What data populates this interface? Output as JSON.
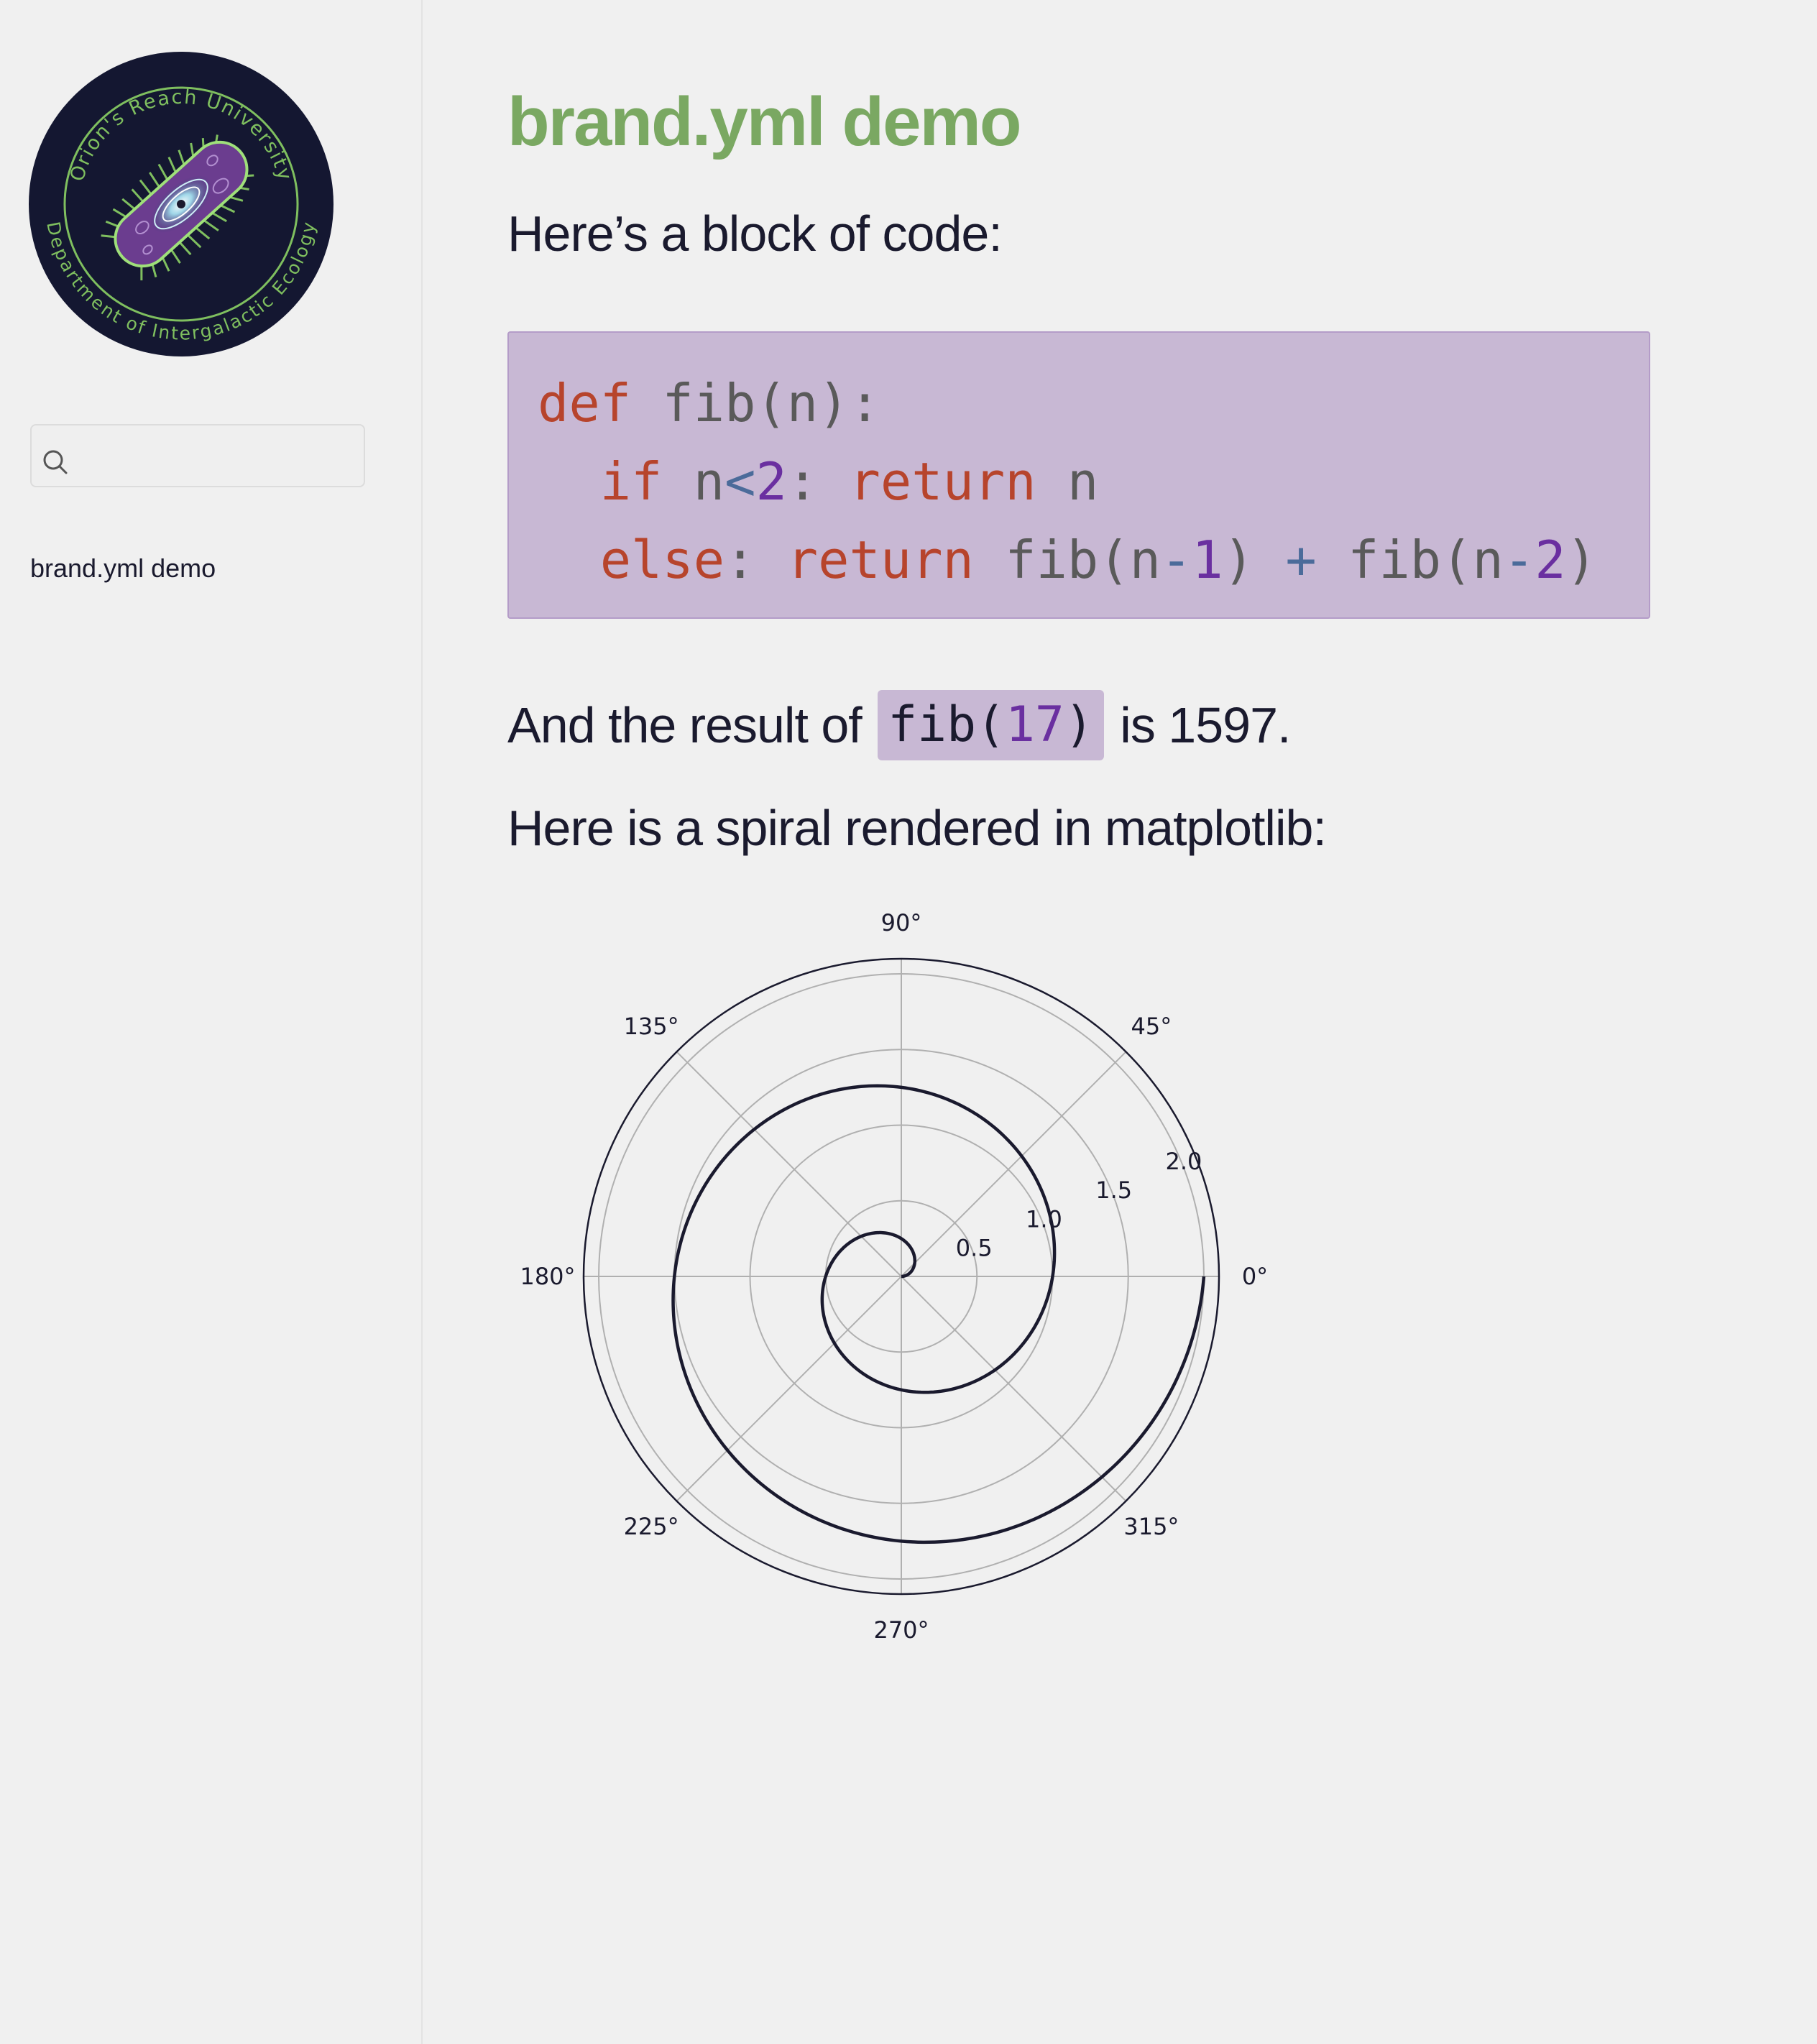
{
  "sidebar": {
    "logo": {
      "top_text": "Orion's Reach University",
      "bottom_text": "Department of Intergalactic Ecology",
      "colors": {
        "ring": "#141731",
        "accent": "#7fbf5f",
        "galaxy": "#6b3d8f"
      }
    },
    "search": {
      "placeholder": "",
      "value": "",
      "icon": "search-icon"
    },
    "nav": [
      {
        "label": "brand.yml demo"
      }
    ]
  },
  "main": {
    "title": "brand.yml demo",
    "intro": "Here’s a block of code:",
    "code_lines": [
      [
        {
          "t": "def",
          "c": "kw"
        },
        {
          "t": " fib(n):",
          "c": ""
        }
      ],
      [
        {
          "t": "  ",
          "c": ""
        },
        {
          "t": "if",
          "c": "kw"
        },
        {
          "t": " n",
          "c": ""
        },
        {
          "t": "<",
          "c": "op"
        },
        {
          "t": "2",
          "c": "num"
        },
        {
          "t": ": ",
          "c": ""
        },
        {
          "t": "return",
          "c": "kw"
        },
        {
          "t": " n",
          "c": ""
        }
      ],
      [
        {
          "t": "  ",
          "c": ""
        },
        {
          "t": "else",
          "c": "kw"
        },
        {
          "t": ": ",
          "c": ""
        },
        {
          "t": "return",
          "c": "kw"
        },
        {
          "t": " fib(n",
          "c": ""
        },
        {
          "t": "-",
          "c": "op"
        },
        {
          "t": "1",
          "c": "num"
        },
        {
          "t": ") ",
          "c": ""
        },
        {
          "t": "+",
          "c": "op"
        },
        {
          "t": " fib(n",
          "c": ""
        },
        {
          "t": "-",
          "c": "op"
        },
        {
          "t": "2",
          "c": "num"
        },
        {
          "t": ")",
          "c": ""
        }
      ]
    ],
    "result_prefix": "And the result of ",
    "result_code_fn": "fib(",
    "result_code_arg": "17",
    "result_code_close": ")",
    "result_suffix": " is 1597.",
    "chart_intro": "Here is a spiral rendered in matplotlib:",
    "colors": {
      "title": "#7aa862",
      "text": "#1a1a2e",
      "code_bg": "#c8b8d4",
      "keyword": "#b7442c",
      "number": "#6a2fa0",
      "operator": "#4b6b9a"
    }
  },
  "chart_data": {
    "type": "line",
    "projection": "polar",
    "title": "",
    "theta_tick_labels": [
      "0°",
      "45°",
      "90°",
      "135°",
      "180°",
      "225°",
      "270°",
      "315°"
    ],
    "r_tick_values": [
      0.5,
      1.0,
      1.5,
      2.0
    ],
    "r_tick_labels": [
      "0.5",
      "1.0",
      "1.5",
      "2.0"
    ],
    "rlim": [
      0,
      2.1
    ],
    "r_label_angle_deg": 22.5,
    "grid": true,
    "series": [
      {
        "r_equals_theta_over": 6.2832,
        "theta_range_rad": [
          0,
          12.5664
        ],
        "r_range": [
          0,
          2
        ],
        "samples": [
          {
            "theta_deg": 0,
            "r": 0.0
          },
          {
            "theta_deg": 90,
            "r": 0.25
          },
          {
            "theta_deg": 180,
            "r": 0.5
          },
          {
            "theta_deg": 270,
            "r": 0.75
          },
          {
            "theta_deg": 360,
            "r": 1.0
          },
          {
            "theta_deg": 450,
            "r": 1.25
          },
          {
            "theta_deg": 540,
            "r": 1.5
          },
          {
            "theta_deg": 630,
            "r": 1.75
          },
          {
            "theta_deg": 720,
            "r": 2.0
          }
        ],
        "color": "#1a1a2e"
      }
    ]
  }
}
